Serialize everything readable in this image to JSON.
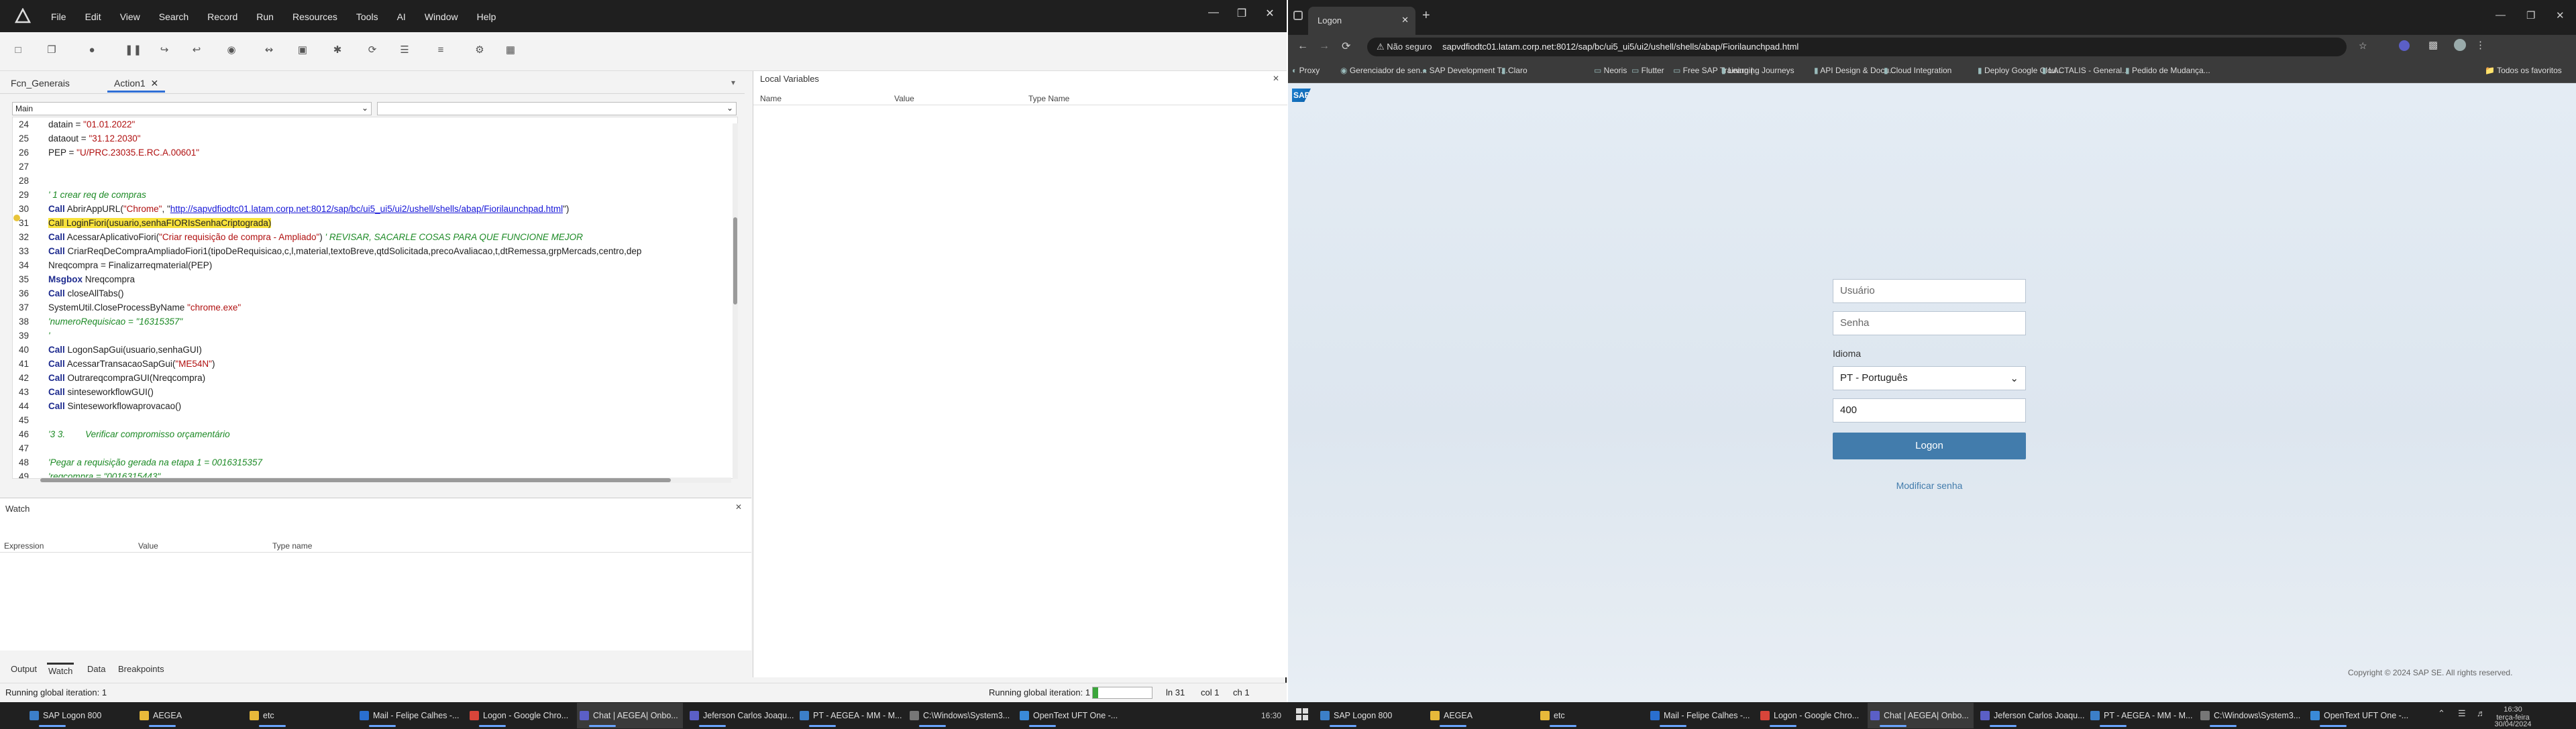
{
  "uft": {
    "menu": [
      "File",
      "Edit",
      "View",
      "Search",
      "Record",
      "Run",
      "Resources",
      "Tools",
      "AI",
      "Window",
      "Help"
    ],
    "tabs": [
      {
        "label": "Fcn_Generais"
      },
      {
        "label": "Action1"
      }
    ],
    "combo_left": "Main",
    "code_lines": [
      {
        "n": "24",
        "parts": [
          {
            "t": "    datain = ",
            "c": ""
          },
          {
            "t": "\"01.01.2022\"",
            "c": "str"
          }
        ]
      },
      {
        "n": "25",
        "parts": [
          {
            "t": "    dataout = ",
            "c": ""
          },
          {
            "t": "\"31.12.2030\"",
            "c": "str"
          }
        ]
      },
      {
        "n": "26",
        "parts": [
          {
            "t": "    PEP = ",
            "c": ""
          },
          {
            "t": "\"U/PRC.23035.E.RC.A.00601\"",
            "c": "str"
          }
        ]
      },
      {
        "n": "27",
        "parts": []
      },
      {
        "n": "28",
        "parts": []
      },
      {
        "n": "29",
        "parts": [
          {
            "t": "    ' 1 crear req de compras",
            "c": "cm"
          }
        ]
      },
      {
        "n": "30",
        "parts": [
          {
            "t": "    ",
            "c": ""
          },
          {
            "t": "Call",
            "c": "kw"
          },
          {
            "t": " AbrirAppURL(",
            "c": ""
          },
          {
            "t": "\"Chrome\"",
            "c": "str"
          },
          {
            "t": ", \"",
            "c": ""
          },
          {
            "t": "http://sapvdfiodtc01.latam.corp.net:8012/sap/bc/ui5_ui5/ui2/ushell/shells/abap/Fiorilaunchpad.html",
            "c": "url"
          },
          {
            "t": "\")",
            "c": ""
          }
        ]
      },
      {
        "n": "31",
        "parts": [
          {
            "t": "    ",
            "c": ""
          },
          {
            "t": "Call LoginFiori(usuario,senhaFIORIsSenhaCriptograda)",
            "c": "hl"
          }
        ]
      },
      {
        "n": "32",
        "parts": [
          {
            "t": "    ",
            "c": ""
          },
          {
            "t": "Call",
            "c": "kw"
          },
          {
            "t": " AcessarAplicativoFiori(",
            "c": ""
          },
          {
            "t": "\"Criar requisição de compra - Ampliado\"",
            "c": "str"
          },
          {
            "t": ") ",
            "c": ""
          },
          {
            "t": "' REVISAR, SACARLE COSAS PARA QUE FUNCIONE MEJOR",
            "c": "cm"
          }
        ]
      },
      {
        "n": "33",
        "parts": [
          {
            "t": "    ",
            "c": ""
          },
          {
            "t": "Call",
            "c": "kw"
          },
          {
            "t": " CriarReqDeCompraAmpliadoFiori1(tipoDeRequisicao,c,l,material,textoBreve,qtdSolicitada,precoAvaliacao,t,dtRemessa,grpMercads,centro,dep",
            "c": ""
          }
        ]
      },
      {
        "n": "34",
        "parts": [
          {
            "t": "    Nreqcompra = Finalizarreqmaterial(PEP)",
            "c": ""
          }
        ]
      },
      {
        "n": "35",
        "parts": [
          {
            "t": "    ",
            "c": ""
          },
          {
            "t": "Msgbox",
            "c": "kw"
          },
          {
            "t": " Nreqcompra",
            "c": ""
          }
        ]
      },
      {
        "n": "36",
        "parts": [
          {
            "t": "    ",
            "c": ""
          },
          {
            "t": "Call",
            "c": "kw"
          },
          {
            "t": " closeAllTabs()",
            "c": ""
          }
        ]
      },
      {
        "n": "37",
        "parts": [
          {
            "t": "    SystemUtil.CloseProcessByName ",
            "c": ""
          },
          {
            "t": "\"chrome.exe\"",
            "c": "str"
          }
        ]
      },
      {
        "n": "38",
        "parts": [
          {
            "t": "    'numeroRequisicao = \"16315357\"",
            "c": "cm"
          }
        ]
      },
      {
        "n": "39",
        "parts": [
          {
            "t": "    '",
            "c": "cm"
          }
        ]
      },
      {
        "n": "40",
        "parts": [
          {
            "t": "    ",
            "c": ""
          },
          {
            "t": "Call",
            "c": "kw"
          },
          {
            "t": " LogonSapGui(usuario,senhaGUI)",
            "c": ""
          }
        ]
      },
      {
        "n": "41",
        "parts": [
          {
            "t": "    ",
            "c": ""
          },
          {
            "t": "Call",
            "c": "kw"
          },
          {
            "t": " AcessarTransacaoSapGui(",
            "c": ""
          },
          {
            "t": "\"ME54N\"",
            "c": "str"
          },
          {
            "t": ")",
            "c": ""
          }
        ]
      },
      {
        "n": "42",
        "parts": [
          {
            "t": "    ",
            "c": ""
          },
          {
            "t": "Call",
            "c": "kw"
          },
          {
            "t": " OutrareqcompraGUI(Nreqcompra)",
            "c": ""
          }
        ]
      },
      {
        "n": "43",
        "parts": [
          {
            "t": "    ",
            "c": ""
          },
          {
            "t": "Call",
            "c": "kw"
          },
          {
            "t": " sinteseworkflowGUI()",
            "c": ""
          }
        ]
      },
      {
        "n": "44",
        "parts": [
          {
            "t": "    ",
            "c": ""
          },
          {
            "t": "Call",
            "c": "kw"
          },
          {
            "t": " Sinteseworkflowaprovacao()",
            "c": ""
          }
        ]
      },
      {
        "n": "45",
        "parts": []
      },
      {
        "n": "46",
        "parts": [
          {
            "t": "    '3 3.        Verificar compromisso orçamentário",
            "c": "cm"
          }
        ]
      },
      {
        "n": "47",
        "parts": []
      },
      {
        "n": "48",
        "parts": [
          {
            "t": "    'Pegar a requisição gerada na etapa 1 = 0016315357",
            "c": "cm"
          }
        ]
      },
      {
        "n": "49",
        "parts": [
          {
            "t": "    'reqcompra = \"0016315443\"",
            "c": "cm"
          }
        ]
      }
    ],
    "watch": {
      "title": "Watch",
      "cols": [
        "Expression",
        "Value",
        "Type name"
      ]
    },
    "locals": {
      "title": "Local Variables",
      "cols": [
        "Name",
        "Value",
        "Type Name"
      ]
    },
    "bottom_tabs": [
      "Output",
      "Watch",
      "Data",
      "Breakpoints"
    ],
    "status_left": "Running global iteration: 1",
    "status_mid": "Running global iteration: 1",
    "status_ln": "ln 31",
    "status_col": "col 1",
    "status_ch": "ch 1"
  },
  "chrome": {
    "tab_title": "Logon",
    "security": "Não seguro",
    "url": "sapvdfiodtc01.latam.corp.net:8012/sap/bc/ui5_ui5/ui2/ushell/shells/abap/Fiorilaunchpad.html",
    "bookmarks": [
      "Proxy",
      "Gerenciador de sen...",
      "SAP Development T...",
      "Claro",
      "Neoris",
      "Flutter",
      "Free SAP Training |...",
      "Learning Journeys",
      "API Design & Docu...",
      "Cloud Integration",
      "Deploy Google Clou...",
      "LACTALIS - General...",
      "Pedido de Mudança..."
    ],
    "all_bookmarks": "Todos os favoritos"
  },
  "sap": {
    "logo": "SAP",
    "user_placeholder": "Usuário",
    "pass_placeholder": "Senha",
    "lang_label": "Idioma",
    "lang_value": "PT - Português",
    "client": "400",
    "logon": "Logon",
    "change_pw": "Modificar senha",
    "copyright": "Copyright © 2024 SAP SE. All rights reserved."
  },
  "taskbar": {
    "left_items": [
      {
        "label": "SAP Logon 800",
        "color": "#3c7fc8"
      },
      {
        "label": "AEGEA",
        "color": "#e8b93a"
      },
      {
        "label": "etc",
        "color": "#e8b93a"
      },
      {
        "label": "Mail - Felipe Calhes -...",
        "color": "#2a6fd0"
      },
      {
        "label": "Logon - Google Chro...",
        "color": "#d8453a"
      },
      {
        "label": "Chat | AEGEA| Onbo...",
        "color": "#5b5fc7"
      },
      {
        "label": "Jeferson Carlos Joaqu...",
        "color": "#5b5fc7"
      },
      {
        "label": "PT - AEGEA - MM - M...",
        "color": "#3c7fc8"
      },
      {
        "label": "C:\\Windows\\System3...",
        "color": "#777"
      },
      {
        "label": "OpenText UFT One -...",
        "color": "#3a8ad8"
      }
    ],
    "right_items": [
      {
        "label": "SAP Logon 800",
        "color": "#3c7fc8"
      },
      {
        "label": "AEGEA",
        "color": "#e8b93a"
      },
      {
        "label": "etc",
        "color": "#e8b93a"
      },
      {
        "label": "Mail - Felipe Calhes -...",
        "color": "#2a6fd0"
      },
      {
        "label": "Logon - Google Chro...",
        "color": "#d8453a"
      },
      {
        "label": "Chat | AEGEA| Onbo...",
        "color": "#5b5fc7"
      },
      {
        "label": "Jeferson Carlos Joaqu...",
        "color": "#5b5fc7"
      },
      {
        "label": "PT - AEGEA - MM - M...",
        "color": "#3c7fc8"
      },
      {
        "label": "C:\\Windows\\System3...",
        "color": "#777"
      },
      {
        "label": "OpenText UFT One -...",
        "color": "#3a8ad8"
      }
    ],
    "clock_left": "16:30",
    "clock_time": "16:30",
    "clock_day": "terça-feira",
    "clock_date": "30/04/2024"
  }
}
